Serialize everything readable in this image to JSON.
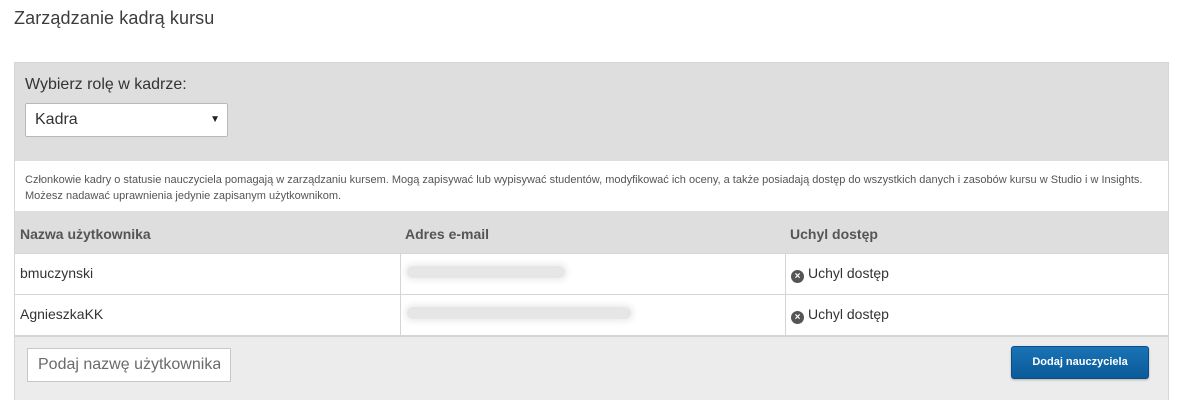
{
  "page": {
    "title": "Zarządzanie kadrą kursu"
  },
  "role": {
    "label": "Wybierz rolę w kadrze:",
    "selected": "Kadra"
  },
  "description": "Członkowie kadry o statusie nauczyciela pomagają w zarządzaniu kursem. Mogą zapisywać lub wypisywać studentów, modyfikować ich oceny, a także posiadają dostęp do wszystkich danych i zasobów kursu w Studio i w Insights. Możesz nadawać uprawnienia jedynie zapisanym użytkownikom.",
  "table": {
    "headers": {
      "username": "Nazwa użytkownika",
      "email": "Adres e-mail",
      "revoke": "Uchyl dostęp"
    },
    "rows": [
      {
        "username": "bmuczynski",
        "revoke_label": "Uchyl dostęp"
      },
      {
        "username": "AgnieszkaKK",
        "revoke_label": "Uchyl dostęp"
      }
    ]
  },
  "footer": {
    "input_placeholder": "Podaj nazwę użytkownika",
    "add_button": "Dodaj nauczyciela"
  },
  "colors": {
    "primary_button": "#0a5a99",
    "panel_bg": "#dedede"
  }
}
